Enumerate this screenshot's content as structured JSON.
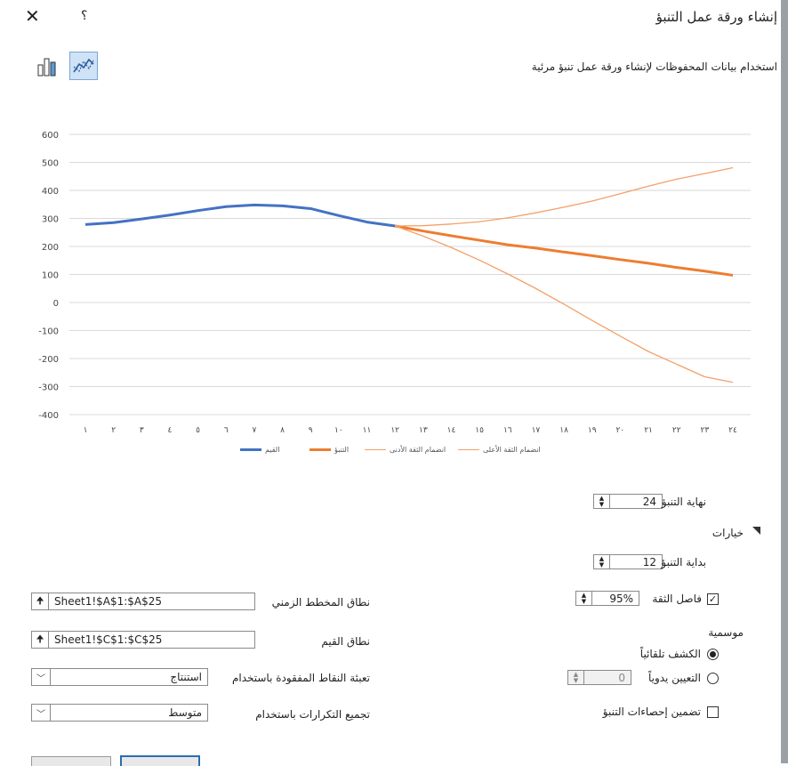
{
  "window": {
    "title": "إنشاء ورقة عمل التنبؤ",
    "close_glyph": "✕",
    "help_glyph": "؟"
  },
  "header": {
    "subtitle": "استخدام بيانات المحفوظات لإنشاء ورقة عمل تنبؤ مرئية",
    "line_chart_icon": "line-chart-icon",
    "column_chart_icon": "column-chart-icon"
  },
  "chart_data": {
    "type": "line",
    "x": [
      1,
      2,
      3,
      4,
      5,
      6,
      7,
      8,
      9,
      10,
      11,
      12,
      13,
      14,
      15,
      16,
      17,
      18,
      19,
      20,
      21,
      22,
      23,
      24
    ],
    "x_tick_labels": [
      "١",
      "٢",
      "٣",
      "٤",
      "٥",
      "٦",
      "٧",
      "٨",
      "٩",
      "١٠",
      "١١",
      "١٢",
      "١٣",
      "١٤",
      "١٥",
      "١٦",
      "١٧",
      "١٨",
      "١٩",
      "٢٠",
      "٢١",
      "٢٢",
      "٢٣",
      "٢٤"
    ],
    "y_tick_labels": [
      "600",
      "500",
      "400",
      "300",
      "200",
      "100",
      "0",
      "-100",
      "-200",
      "-300",
      "-400"
    ],
    "ylim": [
      -400,
      600
    ],
    "grid": true,
    "legend_position": "bottom",
    "series": [
      {
        "name": "القيم",
        "color": "#4472c4",
        "width": 3,
        "x": [
          1,
          2,
          3,
          4,
          5,
          6,
          7,
          8,
          9,
          10,
          11,
          12
        ],
        "values": [
          278,
          285,
          298,
          312,
          328,
          342,
          348,
          345,
          335,
          310,
          287,
          273
        ]
      },
      {
        "name": "التنبؤ",
        "color": "#ed7d31",
        "width": 3,
        "x": [
          12,
          13,
          14,
          15,
          16,
          17,
          18,
          19,
          20,
          21,
          22,
          23,
          24
        ],
        "values": [
          273,
          255,
          238,
          222,
          206,
          194,
          180,
          167,
          153,
          140,
          125,
          112,
          97
        ]
      },
      {
        "name": "انضمام الثقة الأدنى",
        "color": "#f4a06a",
        "width": 1.3,
        "x": [
          12,
          13,
          14,
          15,
          16,
          17,
          18,
          19,
          20,
          21,
          22,
          23,
          24
        ],
        "values": [
          273,
          237,
          196,
          151,
          102,
          50,
          -6,
          -64,
          -120,
          -175,
          -220,
          -265,
          -285
        ]
      },
      {
        "name": "انضمام الثقة الأعلى",
        "color": "#f4a06a",
        "width": 1.3,
        "x": [
          12,
          13,
          14,
          15,
          16,
          17,
          18,
          19,
          20,
          21,
          22,
          23,
          24
        ],
        "values": [
          273,
          274,
          280,
          288,
          302,
          320,
          340,
          362,
          388,
          415,
          440,
          460,
          481
        ]
      }
    ]
  },
  "options": {
    "forecast_end_label": "نهاية التنبؤ",
    "forecast_end_value": "24",
    "options_toggle_label": "خيارات",
    "forecast_start_label": "بداية التنبؤ",
    "forecast_start_value": "12",
    "confidence_label": "فاصل الثقة",
    "confidence_value": "95%",
    "confidence_checked": true,
    "seasonality_label": "موسمية",
    "auto_detect_label": "الكشف تلقائياً",
    "manual_label": "التعيين يدوياً",
    "manual_value": "0",
    "include_stats_label": "تضمين إحصاءات التنبؤ",
    "timeline_label": "نطاق المخطط الزمني",
    "timeline_value": "Sheet1!$A$1:$A$25",
    "values_label": "نطاق القيم",
    "values_value": "Sheet1!$C$1:$C$25",
    "missing_label": "تعبئة النقاط المفقودة باستخدام",
    "missing_value": "استنتاج",
    "duplicates_label": "تجميع التكرارات باستخدام",
    "duplicates_value": "متوسط"
  }
}
